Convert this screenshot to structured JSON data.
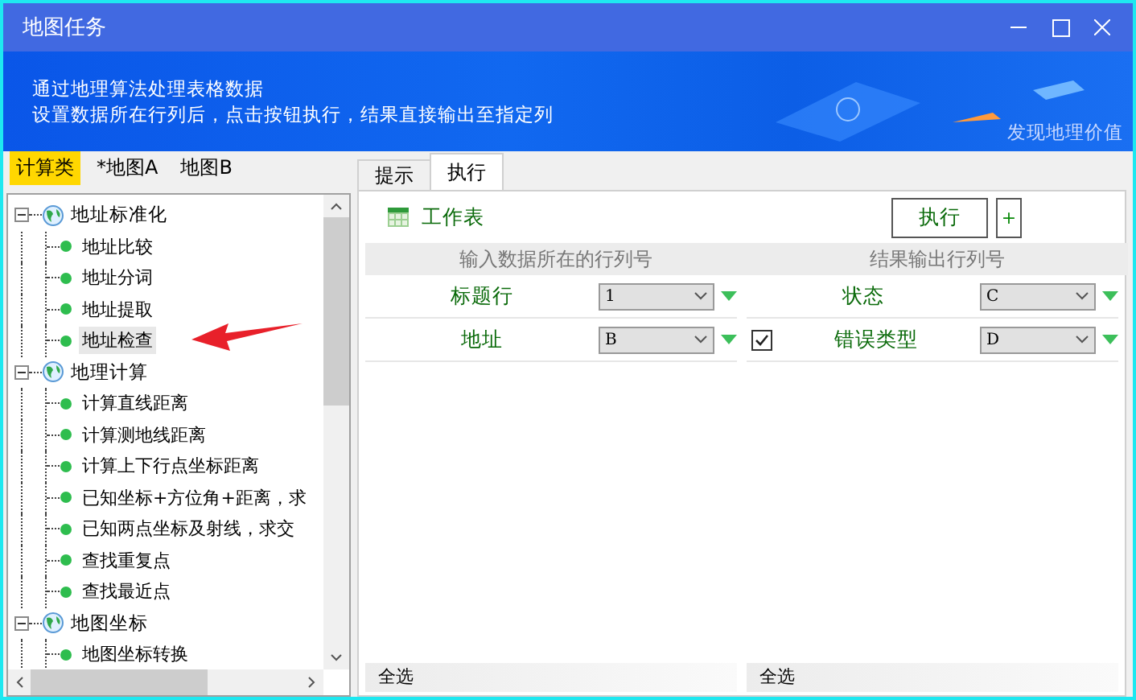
{
  "window": {
    "title": "地图任务"
  },
  "banner": {
    "lines": [
      "通过地理算法处理表格数据",
      "设置数据所在行列后，点击按钮执行，结果直接输出至指定列"
    ],
    "slogan": "发现地理价值"
  },
  "left_tabs": [
    {
      "label": "计算类",
      "selected": true
    },
    {
      "label": "*地图A",
      "selected": false
    },
    {
      "label": "地图B",
      "selected": false
    }
  ],
  "tree": [
    {
      "label": "地址标准化",
      "expanded": true,
      "children": [
        {
          "label": "地址比较",
          "selected": false
        },
        {
          "label": "地址分词",
          "selected": false
        },
        {
          "label": "地址提取",
          "selected": false
        },
        {
          "label": "地址检查",
          "selected": true
        }
      ]
    },
    {
      "label": "地理计算",
      "expanded": true,
      "children": [
        {
          "label": "计算直线距离",
          "selected": false
        },
        {
          "label": "计算测地线距离",
          "selected": false
        },
        {
          "label": "计算上下行点坐标距离",
          "selected": false
        },
        {
          "label": "已知坐标+方位角+距离，求",
          "selected": false
        },
        {
          "label": "已知两点坐标及射线，求交",
          "selected": false
        },
        {
          "label": "查找重复点",
          "selected": false
        },
        {
          "label": "查找最近点",
          "selected": false
        }
      ]
    },
    {
      "label": "地图坐标",
      "expanded": true,
      "children": [
        {
          "label": "地图坐标转换",
          "selected": false
        }
      ]
    }
  ],
  "right_tabs": [
    {
      "label": "提示",
      "selected": false
    },
    {
      "label": "执行",
      "selected": true
    }
  ],
  "toolbar": {
    "sheet_label": "工作表",
    "run_button": "执行",
    "add_button": "+"
  },
  "input_panel": {
    "header": "输入数据所在的行列号",
    "rows": [
      {
        "kind": "plain",
        "label": "标题行",
        "value": "1"
      },
      {
        "kind": "plain",
        "label": "地址",
        "value": "B"
      }
    ],
    "footer": "全选"
  },
  "output_panel": {
    "header": "结果输出行列号",
    "rows": [
      {
        "kind": "plain",
        "label": "状态",
        "value": "C"
      },
      {
        "kind": "check",
        "checked": true,
        "label": "错误类型",
        "value": "D"
      }
    ],
    "footer": "全选"
  }
}
